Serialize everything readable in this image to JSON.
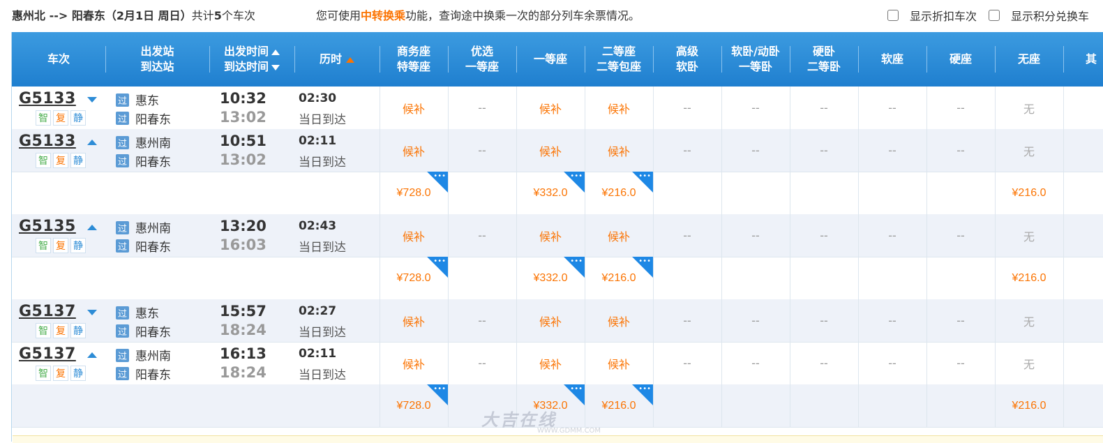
{
  "topbar": {
    "route_prefix": "惠州北 --> 阳春东（2月1日  周日）",
    "count_prefix": "共计",
    "count": "5",
    "count_suffix": "个车次",
    "tip_before": "您可使用",
    "tip_link": "中转换乘",
    "tip_after": "功能，查询途中换乘一次的部分列车余票情况。",
    "opt_discount": "显示折扣车次",
    "opt_points": "显示积分兑换车"
  },
  "header": {
    "train": "车次",
    "station1": "出发站",
    "station2": "到达站",
    "time1": "出发时间",
    "time2": "到达时间",
    "duration": "历时",
    "c1a": "商务座",
    "c1b": "特等座",
    "c2a": "优选",
    "c2b": "一等座",
    "c3": "一等座",
    "c4a": "二等座",
    "c4b": "二等包座",
    "c5a": "高级",
    "c5b": "软卧",
    "c6a": "软卧/动卧",
    "c6b": "一等卧",
    "c7a": "硬卧",
    "c7b": "二等卧",
    "c8": "软座",
    "c9": "硬座",
    "c10": "无座",
    "c11": "其"
  },
  "tags": {
    "zhi": "智",
    "fu": "复",
    "jing": "静",
    "guo": "过"
  },
  "trains": [
    {
      "no": "G5133",
      "dir": "down",
      "from": "惠东",
      "to": "阳春东",
      "dep": "10:32",
      "arr": "13:02",
      "dur": "02:30",
      "arrday": "当日到达",
      "seats": [
        "候补",
        "--",
        "候补",
        "候补",
        "--",
        "--",
        "--",
        "--",
        "--",
        "无"
      ]
    },
    {
      "no": "G5133",
      "dir": "up",
      "from": "惠州南",
      "to": "阳春东",
      "dep": "10:51",
      "arr": "13:02",
      "dur": "02:11",
      "arrday": "当日到达",
      "seats": [
        "候补",
        "--",
        "候补",
        "候补",
        "--",
        "--",
        "--",
        "--",
        "--",
        "无"
      ],
      "prices": {
        "c1": "¥728.0",
        "c3": "¥332.0",
        "c4": "¥216.0",
        "c10": "¥216.0"
      }
    },
    {
      "no": "G5135",
      "dir": "up",
      "from": "惠州南",
      "to": "阳春东",
      "dep": "13:20",
      "arr": "16:03",
      "dur": "02:43",
      "arrday": "当日到达",
      "seats": [
        "候补",
        "--",
        "候补",
        "候补",
        "--",
        "--",
        "--",
        "--",
        "--",
        "无"
      ],
      "prices": {
        "c1": "¥728.0",
        "c3": "¥332.0",
        "c4": "¥216.0",
        "c10": "¥216.0"
      }
    },
    {
      "no": "G5137",
      "dir": "down",
      "from": "惠东",
      "to": "阳春东",
      "dep": "15:57",
      "arr": "18:24",
      "dur": "02:27",
      "arrday": "当日到达",
      "seats": [
        "候补",
        "--",
        "候补",
        "候补",
        "--",
        "--",
        "--",
        "--",
        "--",
        "无"
      ]
    },
    {
      "no": "G5137",
      "dir": "up",
      "from": "惠州南",
      "to": "阳春东",
      "dep": "16:13",
      "arr": "18:24",
      "dur": "02:11",
      "arrday": "当日到达",
      "seats": [
        "候补",
        "--",
        "候补",
        "候补",
        "--",
        "--",
        "--",
        "--",
        "--",
        "无"
      ],
      "prices": {
        "c1": "¥728.0",
        "c3": "¥332.0",
        "c4": "¥216.0",
        "c10": "¥216.0"
      }
    }
  ],
  "watermark": {
    "logo": "大吉在线",
    "url": "WWW.GDMM.COM"
  }
}
